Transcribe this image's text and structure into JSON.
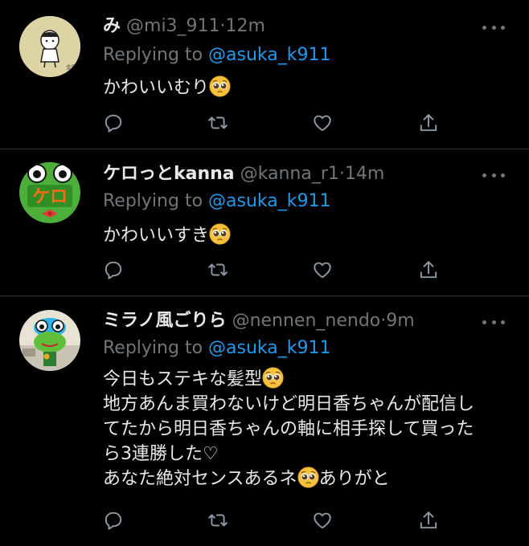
{
  "tweets": [
    {
      "display_name": "み",
      "handle": "@mi3_911",
      "sep": "·",
      "time": "12m",
      "replying_prefix": "Replying to ",
      "replying_to": "@asuka_k911",
      "lines": [
        "かわいいむり"
      ],
      "emoji_after": "pleading-face-emoji"
    },
    {
      "display_name": "ケロっとkanna",
      "handle": "@kanna_r1",
      "sep": "·",
      "time": "14m",
      "replying_prefix": "Replying to ",
      "replying_to": "@asuka_k911",
      "lines": [
        "かわいいすき"
      ],
      "emoji_after": "pleading-face-emoji",
      "avatar_text": "ケロ"
    },
    {
      "display_name": "ミラノ風ごりら",
      "handle": "@nennen_nendo",
      "sep": "·",
      "time": "9m",
      "replying_prefix": "Replying to ",
      "replying_to": "@asuka_k911",
      "lines": [
        "今日もステキな髪型",
        "地方あんま買わないけど明日香ちゃんが配信し",
        "てたから明日香ちゃんの軸に相手探して買った",
        "ら3連勝した♡",
        "あなた絶対センスあるネ",
        "ありがと"
      ]
    }
  ],
  "icons": {
    "reply": "reply-icon",
    "retweet": "retweet-icon",
    "like": "heart-icon",
    "share": "share-icon",
    "more": "more-icon"
  },
  "colors": {
    "background": "#000000",
    "text": "#e7e9ea",
    "muted": "#71767b",
    "link": "#1d9bf0",
    "divider": "#2f3336"
  }
}
